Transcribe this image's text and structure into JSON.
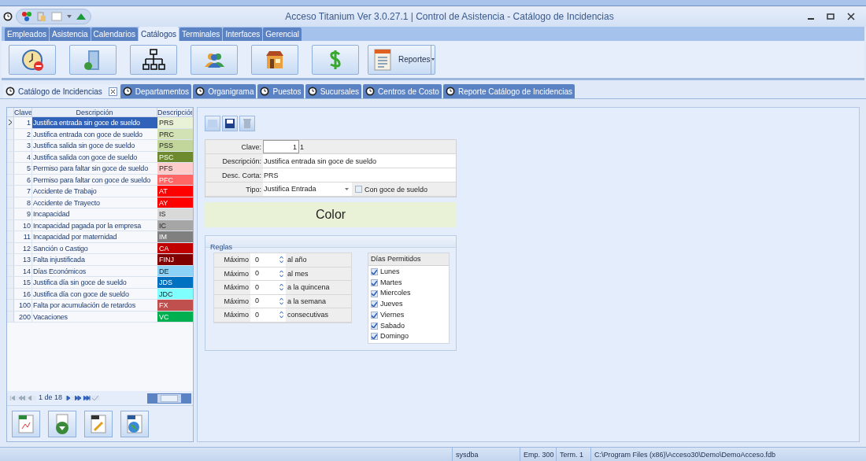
{
  "window": {
    "title": "Acceso Titanium  Ver 3.0.27.1 | Control de Asistencia - Catálogo de Incidencias"
  },
  "ribbon_tabs": [
    {
      "label": "Empleados",
      "selected": false
    },
    {
      "label": "Asistencia",
      "selected": false
    },
    {
      "label": "Calendarios",
      "selected": false
    },
    {
      "label": "Catálogos",
      "selected": true
    },
    {
      "label": "Terminales",
      "selected": false
    },
    {
      "label": "Interfaces",
      "selected": false
    },
    {
      "label": "Gerencial",
      "selected": false
    }
  ],
  "ribbon_buttons": [
    {
      "kind": "clock"
    },
    {
      "kind": "building"
    },
    {
      "kind": "orgchart"
    },
    {
      "kind": "people"
    },
    {
      "kind": "store"
    },
    {
      "kind": "money"
    },
    {
      "kind": "reports",
      "label": "Reportes"
    }
  ],
  "doc_tabs": [
    {
      "label": "Catálogo de Incidencias",
      "selected": true
    },
    {
      "label": "Departamentos",
      "selected": false
    },
    {
      "label": "Organigrama",
      "selected": false
    },
    {
      "label": "Puestos",
      "selected": false
    },
    {
      "label": "Sucursales",
      "selected": false
    },
    {
      "label": "Centros de Costo",
      "selected": false
    },
    {
      "label": "Reporte Catálogo de Incidencias",
      "selected": false
    }
  ],
  "grid": {
    "columns": [
      "Clave",
      "Descripción",
      "Descripciór"
    ],
    "rows": [
      {
        "clave": "1",
        "descripcion": "Justifica entrada sin goce de sueldo",
        "code": "PRS",
        "color": "#e9f1d6",
        "selected": true
      },
      {
        "clave": "2",
        "descripcion": "Justifica entrada con goce de sueldo",
        "code": "PRC",
        "color": "#d3e2b5",
        "selected": false
      },
      {
        "clave": "3",
        "descripcion": "Justifica salida sin goce de sueldo",
        "code": "PSS",
        "color": "#c2d69b",
        "selected": false
      },
      {
        "clave": "4",
        "descripcion": "Justifica salida con goce de sueldo",
        "code": "PSC",
        "color": "#6e8a2e",
        "selected": false
      },
      {
        "clave": "5",
        "descripcion": "Permiso para faltar sin goce de sueldo",
        "code": "PFS",
        "color": "#ffcccc",
        "selected": false
      },
      {
        "clave": "6",
        "descripcion": "Permiso para faltar con goce de sueldo",
        "code": "PFC",
        "color": "#ff6666",
        "selected": false
      },
      {
        "clave": "7",
        "descripcion": "Accidente de Trabajo",
        "code": "AT",
        "color": "#ff0000",
        "selected": false
      },
      {
        "clave": "8",
        "descripcion": "Accidente de Trayecto",
        "code": "AY",
        "color": "#ff0000",
        "selected": false
      },
      {
        "clave": "9",
        "descripcion": "Incapacidad",
        "code": "IS",
        "color": "#d9d9d9",
        "selected": false
      },
      {
        "clave": "10",
        "descripcion": "Incapacidad pagada por la empresa",
        "code": "IC",
        "color": "#a6a6a6",
        "selected": false
      },
      {
        "clave": "11",
        "descripcion": "Incapacidad por maternidad",
        "code": "IM",
        "color": "#808080",
        "selected": false
      },
      {
        "clave": "12",
        "descripcion": "Sanción o Castigo",
        "code": "CA",
        "color": "#c00000",
        "selected": false
      },
      {
        "clave": "13",
        "descripcion": "Falta injustificada",
        "code": "FINJ",
        "color": "#800000",
        "selected": false
      },
      {
        "clave": "14",
        "descripcion": "Días Económicos",
        "code": "DE",
        "color": "#8dd3f7",
        "selected": false
      },
      {
        "clave": "15",
        "descripcion": "Justifica día sin goce de sueldo",
        "code": "JDS",
        "color": "#0070c0",
        "selected": false
      },
      {
        "clave": "16",
        "descripcion": "Justifica día con goce de sueldo",
        "code": "JDC",
        "color": "#80ffff",
        "selected": false
      },
      {
        "clave": "100",
        "descripcion": "Falta por acumulación de retardos",
        "code": "FX",
        "color": "#c0504d",
        "selected": false
      },
      {
        "clave": "200",
        "descripcion": "Vacaciones",
        "code": "VC",
        "color": "#00b050",
        "selected": false
      }
    ]
  },
  "navigator": {
    "position": "1 de 18"
  },
  "export_buttons": [
    {
      "kind": "excel"
    },
    {
      "kind": "download"
    },
    {
      "kind": "text"
    },
    {
      "kind": "web"
    }
  ],
  "form": {
    "fields": [
      {
        "label": "Clave:",
        "kind": "number",
        "value": "1",
        "extra": "1"
      },
      {
        "label": "Descripción:",
        "kind": "text",
        "value": "Justifica entrada sin goce de sueldo"
      },
      {
        "label": "Desc. Corta:",
        "kind": "text",
        "value": "PRS"
      },
      {
        "label": "Tipo:",
        "kind": "select",
        "value": "Justifica Entrada",
        "checkbox_label": "Con goce de sueldo",
        "checked": false
      }
    ],
    "color_label": "Color",
    "color": "#e9f1d6"
  },
  "reglas": {
    "title": "Reglas",
    "rows": [
      {
        "label": "Máximo",
        "value": "0",
        "unit": "al año"
      },
      {
        "label": "Máximo",
        "value": "0",
        "unit": "al mes"
      },
      {
        "label": "Máximo",
        "value": "0",
        "unit": "a la quincena"
      },
      {
        "label": "Máximo",
        "value": "0",
        "unit": "a la semana"
      },
      {
        "label": "Máximo",
        "value": "0",
        "unit": "consecutivas"
      }
    ],
    "dias_title": "Días Permitidos",
    "dias": [
      {
        "label": "Lunes",
        "checked": true
      },
      {
        "label": "Martes",
        "checked": true
      },
      {
        "label": "Miercoles",
        "checked": true
      },
      {
        "label": "Jueves",
        "checked": true
      },
      {
        "label": "Viernes",
        "checked": true
      },
      {
        "label": "Sabado",
        "checked": true
      },
      {
        "label": "Domingo",
        "checked": true
      }
    ]
  },
  "status_bar": {
    "user": "sysdba",
    "employees": "Emp. 300",
    "terminal": "Term. 1",
    "path": "C:\\Program Files (x86)\\Acceso30\\Demo\\DemoAcceso.fdb"
  }
}
